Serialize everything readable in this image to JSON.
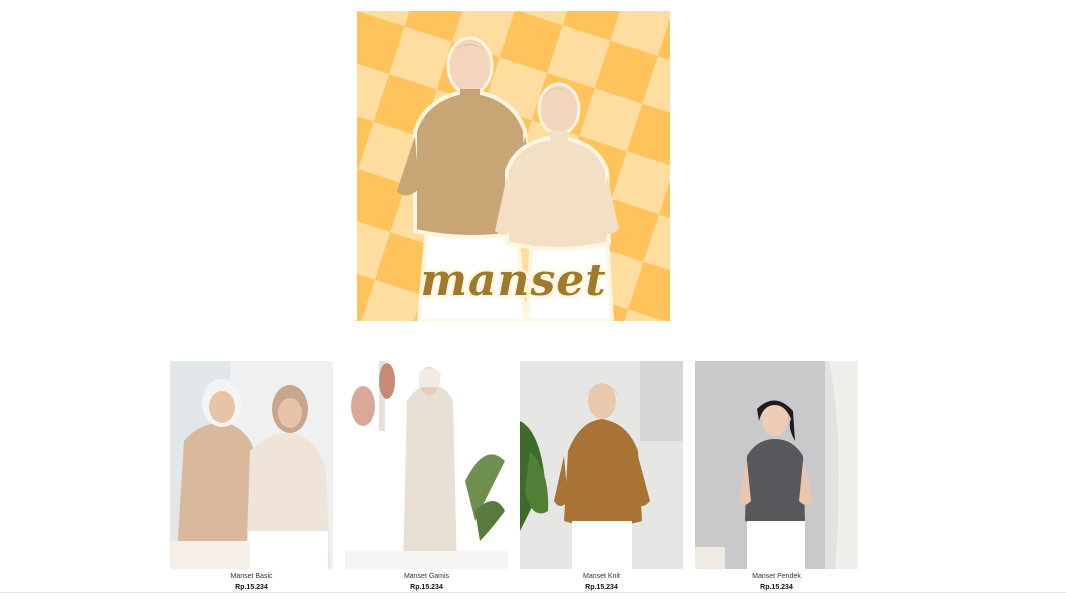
{
  "banner": {
    "title": "manset"
  },
  "colors": {
    "checker_light": "#ffdca0",
    "checker_dark": "#ffc35c",
    "title_color": "#a07a2c"
  },
  "products": [
    {
      "name": "Manset Basic",
      "price": "Rp.15.234"
    },
    {
      "name": "Manset Gamis",
      "price": "Rp.15.234"
    },
    {
      "name": "Manset Knit",
      "price": "Rp.15.234"
    },
    {
      "name": "Manset Pendek",
      "price": "Rp.15.234"
    }
  ]
}
